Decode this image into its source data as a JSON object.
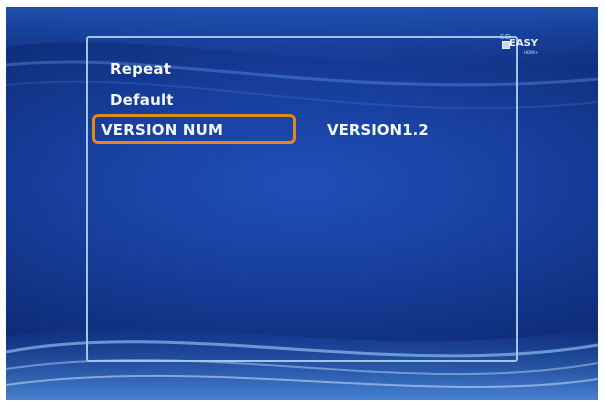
{
  "logo": {
    "top_text": "SD",
    "main_text": "EASY",
    "sub_text": "HDMI+"
  },
  "menu": {
    "items": [
      {
        "label": "Repeat",
        "selected": false
      },
      {
        "label": "Default",
        "selected": false
      },
      {
        "label": "VERSION NUM",
        "selected": true
      }
    ],
    "selected_value": "VERSION1.2"
  },
  "colors": {
    "background": "#173e9c",
    "frame_border": "#9fc6ea",
    "selection_border": "#e08a1a",
    "text": "#f4f7fc"
  }
}
